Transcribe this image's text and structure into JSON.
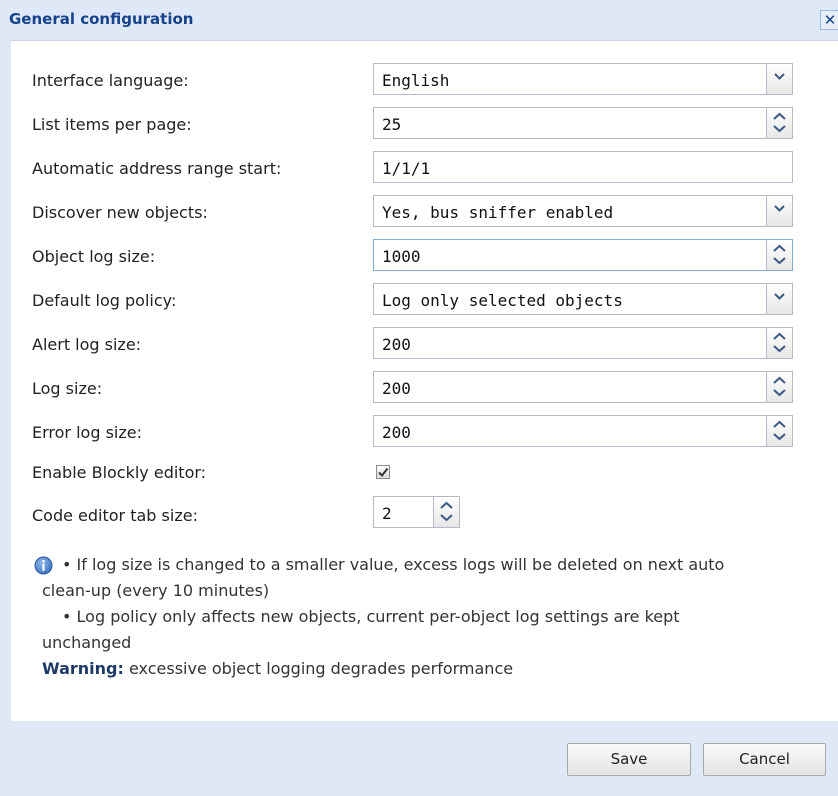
{
  "dialog": {
    "title": "General configuration",
    "close": "✕"
  },
  "fields": [
    {
      "label": "Interface language:",
      "value": "English",
      "kind": "select"
    },
    {
      "label": "List items per page:",
      "value": "25",
      "kind": "spinner"
    },
    {
      "label": "Automatic address range start:",
      "value": "1/1/1",
      "kind": "text"
    },
    {
      "label": "Discover new objects:",
      "value": "Yes, bus sniffer enabled",
      "kind": "select"
    },
    {
      "label": "Object log size:",
      "value": "1000",
      "kind": "spinner"
    },
    {
      "label": "Default log policy:",
      "value": "Log only selected objects",
      "kind": "select"
    },
    {
      "label": "Alert log size:",
      "value": "200",
      "kind": "spinner"
    },
    {
      "label": "Log size:",
      "value": "200",
      "kind": "spinner"
    },
    {
      "label": "Error log size:",
      "value": "200",
      "kind": "spinner"
    },
    {
      "label": "Enable Blockly editor:",
      "checked": true,
      "kind": "checkbox"
    },
    {
      "label": "Code editor tab size:",
      "value": "2",
      "kind": "spinner"
    }
  ],
  "info": {
    "line1": "• If log size is changed to a smaller value, excess logs will be deleted on next auto",
    "line2": "clean-up (every 10 minutes)",
    "line3": "• Log policy only affects new objects, current per-object log settings are kept",
    "line4": "unchanged",
    "warning_label": "Warning:",
    "warning_text": " excessive object logging degrades performance"
  },
  "buttons": {
    "save": "Save",
    "cancel": "Cancel"
  }
}
